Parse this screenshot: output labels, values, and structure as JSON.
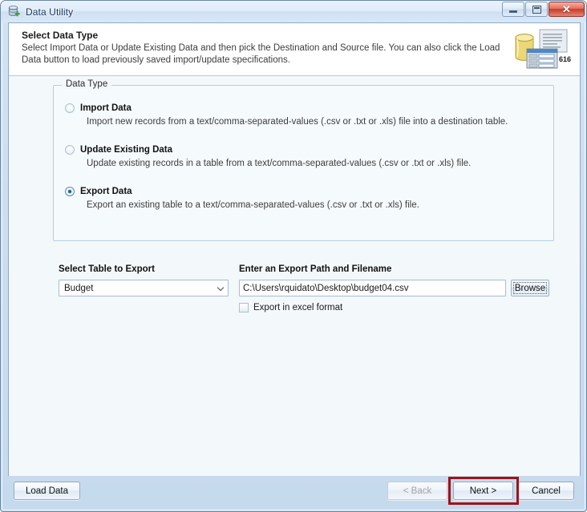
{
  "window": {
    "title": "Data Utility",
    "icon": "database-add-icon",
    "controls": {
      "minimize": "minimize-icon",
      "maximize": "maximize-icon",
      "close": "✕"
    }
  },
  "header": {
    "title": "Select Data Type",
    "description": "Select Import Data or Update Existing Data and then pick the Destination and Source file.  You can also click the Load Data button to load previously saved import/update specifications.",
    "artwork": "database-document-form-icon",
    "artwork_badge": "616"
  },
  "data_type_group": {
    "legend": "Data Type",
    "options": [
      {
        "label": "Import Data",
        "description": "Import new records from a text/comma-separated-values (.csv or .txt or .xls) file into a destination table.",
        "selected": false
      },
      {
        "label": "Update Existing Data",
        "description": "Update existing records in a table from a text/comma-separated-values (.csv or .txt or .xls) file.",
        "selected": false
      },
      {
        "label": "Export Data",
        "description": "Export an existing table to a text/comma-separated-values (.csv or .txt or .xls) file.",
        "selected": true
      }
    ]
  },
  "table_select": {
    "label": "Select Table to Export",
    "value": "Budget",
    "arrow_icon": "chevron-down-icon"
  },
  "export_path": {
    "label": "Enter an Export Path and Filename",
    "value": "C:\\Users\\rquidato\\Desktop\\budget04.csv",
    "browse_label": "Browse"
  },
  "excel_checkbox": {
    "label": "Export in excel format",
    "checked": false
  },
  "footer": {
    "load_data": "Load Data",
    "back": "< Back",
    "next": "Next >",
    "cancel": "Cancel",
    "back_disabled": true
  },
  "annotation": {
    "color": "#a01219",
    "target": "next-button"
  }
}
